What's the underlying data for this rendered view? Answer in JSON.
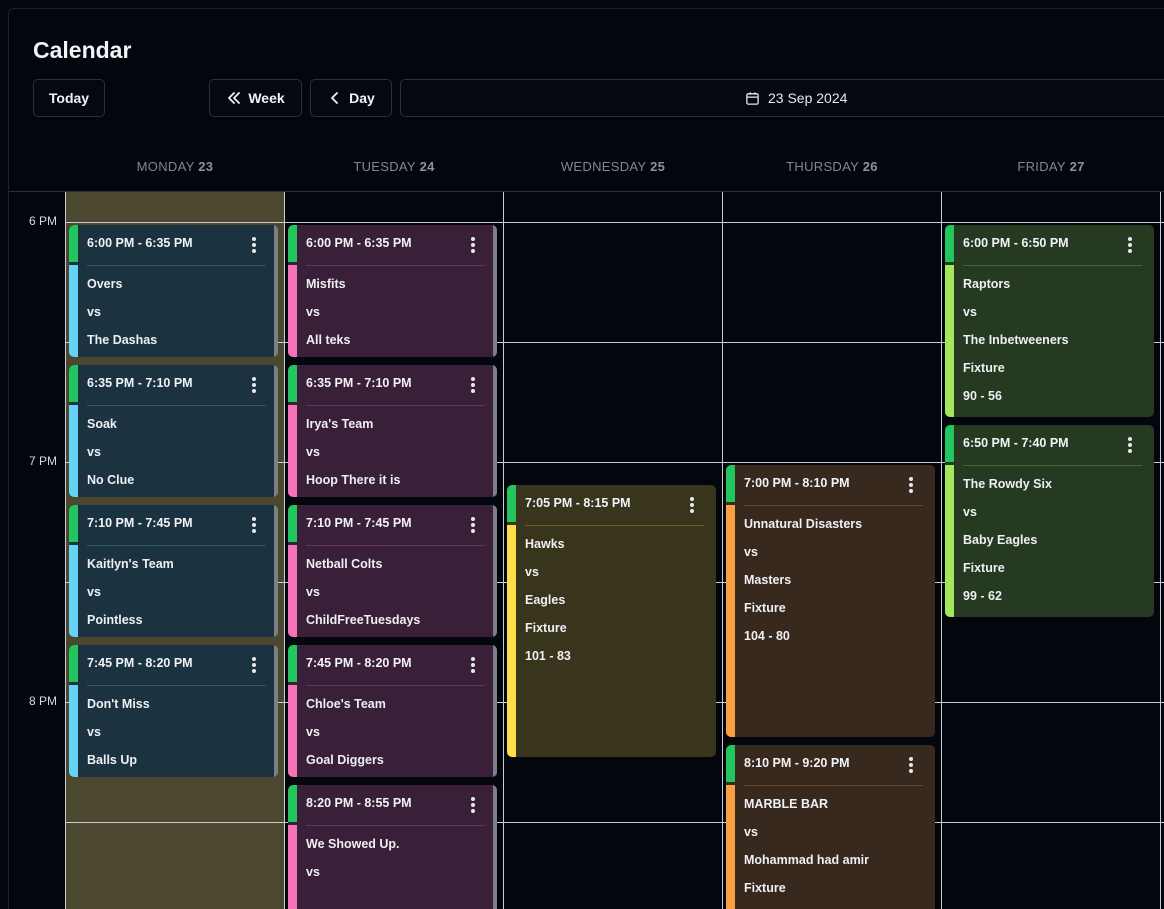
{
  "title": "Calendar",
  "toolbar": {
    "today_label": "Today",
    "week_label": "Week",
    "day_label": "Day",
    "date_label": "23 Sep 2024"
  },
  "days": [
    {
      "name": "MONDAY",
      "num": "23"
    },
    {
      "name": "TUESDAY",
      "num": "24"
    },
    {
      "name": "WEDNESDAY",
      "num": "25"
    },
    {
      "name": "THURSDAY",
      "num": "26"
    },
    {
      "name": "FRIDAY",
      "num": "27"
    }
  ],
  "time_labels": [
    "6 PM",
    "7 PM",
    "8 PM"
  ],
  "colors": {
    "top_accent": "#22c55e",
    "monday_bg": "#4c4830",
    "monday_event": "#1b3340",
    "monday_bar": "#67d3f4",
    "tuesday_event": "#391f37",
    "tuesday_bar": "#f472b6",
    "wednesday_event": "#38351c",
    "wednesday_bar": "#fde047",
    "thursday_event": "#38291f",
    "thursday_bar": "#fb9f45",
    "friday_event": "#253a21",
    "friday_bar": "#a3e85a"
  },
  "events": [
    {
      "day": 0,
      "time": "6:00 PM - 6:35 PM",
      "lines": [
        "Overs",
        "vs",
        "The Dashas"
      ]
    },
    {
      "day": 0,
      "time": "6:35 PM - 7:10 PM",
      "lines": [
        "Soak",
        "vs",
        "No Clue"
      ]
    },
    {
      "day": 0,
      "time": "7:10 PM - 7:45 PM",
      "lines": [
        "Kaitlyn's Team",
        "vs",
        "Pointless"
      ]
    },
    {
      "day": 0,
      "time": "7:45 PM - 8:20 PM",
      "lines": [
        "Don't Miss",
        "vs",
        "Balls Up"
      ]
    },
    {
      "day": 1,
      "time": "6:00 PM - 6:35 PM",
      "lines": [
        "Misfits",
        "vs",
        "All teks"
      ]
    },
    {
      "day": 1,
      "time": "6:35 PM - 7:10 PM",
      "lines": [
        "Irya's Team",
        "vs",
        "Hoop There it is"
      ]
    },
    {
      "day": 1,
      "time": "7:10 PM - 7:45 PM",
      "lines": [
        "Netball Colts",
        "vs",
        "ChildFreeTuesdays"
      ]
    },
    {
      "day": 1,
      "time": "7:45 PM - 8:20 PM",
      "lines": [
        "Chloe's Team",
        "vs",
        "Goal Diggers"
      ]
    },
    {
      "day": 1,
      "time": "8:20 PM - 8:55 PM",
      "lines": [
        "We Showed Up.",
        "vs",
        ""
      ]
    },
    {
      "day": 2,
      "time": "7:05 PM - 8:15 PM",
      "lines": [
        "Hawks",
        "vs",
        "Eagles",
        "Fixture",
        "101 - 83"
      ]
    },
    {
      "day": 3,
      "time": "7:00 PM - 8:10 PM",
      "lines": [
        "Unnatural Disasters",
        "vs",
        "Masters",
        "Fixture",
        "104 - 80"
      ]
    },
    {
      "day": 3,
      "time": "8:10 PM - 9:20 PM",
      "lines": [
        "MARBLE BAR",
        "vs",
        "Mohammad had amir",
        "Fixture"
      ]
    },
    {
      "day": 4,
      "time": "6:00 PM - 6:50 PM",
      "lines": [
        "Raptors",
        "vs",
        "The Inbetweeners",
        "Fixture",
        "90 - 56"
      ]
    },
    {
      "day": 4,
      "time": "6:50 PM - 7:40 PM",
      "lines": [
        "The Rowdy Six",
        "vs",
        "Baby Eagles",
        "Fixture",
        "99 - 62"
      ]
    }
  ]
}
